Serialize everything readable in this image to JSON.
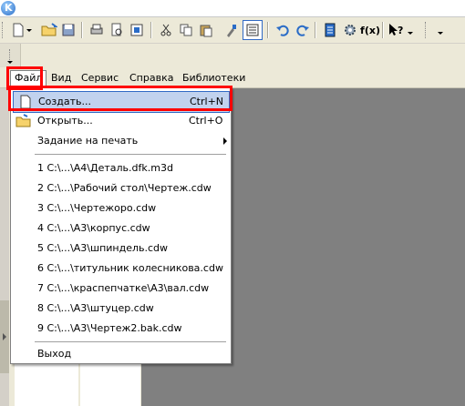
{
  "menubar": {
    "items": [
      {
        "label": "Файл"
      },
      {
        "label": "Вид"
      },
      {
        "label": "Сервис"
      },
      {
        "label": "Справка"
      },
      {
        "label": "Библиотеки"
      }
    ]
  },
  "toolbar": {
    "buttons": [
      "new-icon",
      "open-icon",
      "save-icon",
      "print-icon",
      "print-preview-icon",
      "export-icon",
      "cut-icon",
      "copy-icon",
      "paste-icon",
      "format-brush-icon",
      "properties-icon",
      "undo-icon",
      "redo-icon",
      "manager-icon",
      "gear-icon",
      "function-icon",
      "help-pointer-icon"
    ],
    "fx_label": "f(x)"
  },
  "file_menu": {
    "create": {
      "label": "Создать...",
      "shortcut": "Ctrl+N"
    },
    "open": {
      "label": "Открыть...",
      "shortcut": "Ctrl+O"
    },
    "print_job": {
      "label": "Задание на печать"
    },
    "recent": [
      "1 C:\\...\\А4\\Деталь.dfk.m3d",
      "2 C:\\...\\Рабочий стол\\Чертеж.cdw",
      "3 C:\\...\\Чертежоро.cdw",
      "4 C:\\...\\А3\\корпус.cdw",
      "5 C:\\...\\А3\\шпиндель.cdw",
      "6 C:\\...\\титульник колесникова.cdw",
      "7 C:\\...\\краспепчатке\\А3\\вал.cdw",
      "8 C:\\...\\А3\\штуцер.cdw",
      "9 C:\\...\\А3\\Чертеж2.bak.cdw"
    ],
    "exit": {
      "label": "Выход"
    }
  },
  "colors": {
    "highlight": "#c1d2ee",
    "annotation_red": "#ff0000",
    "workspace_gray": "#808080"
  }
}
